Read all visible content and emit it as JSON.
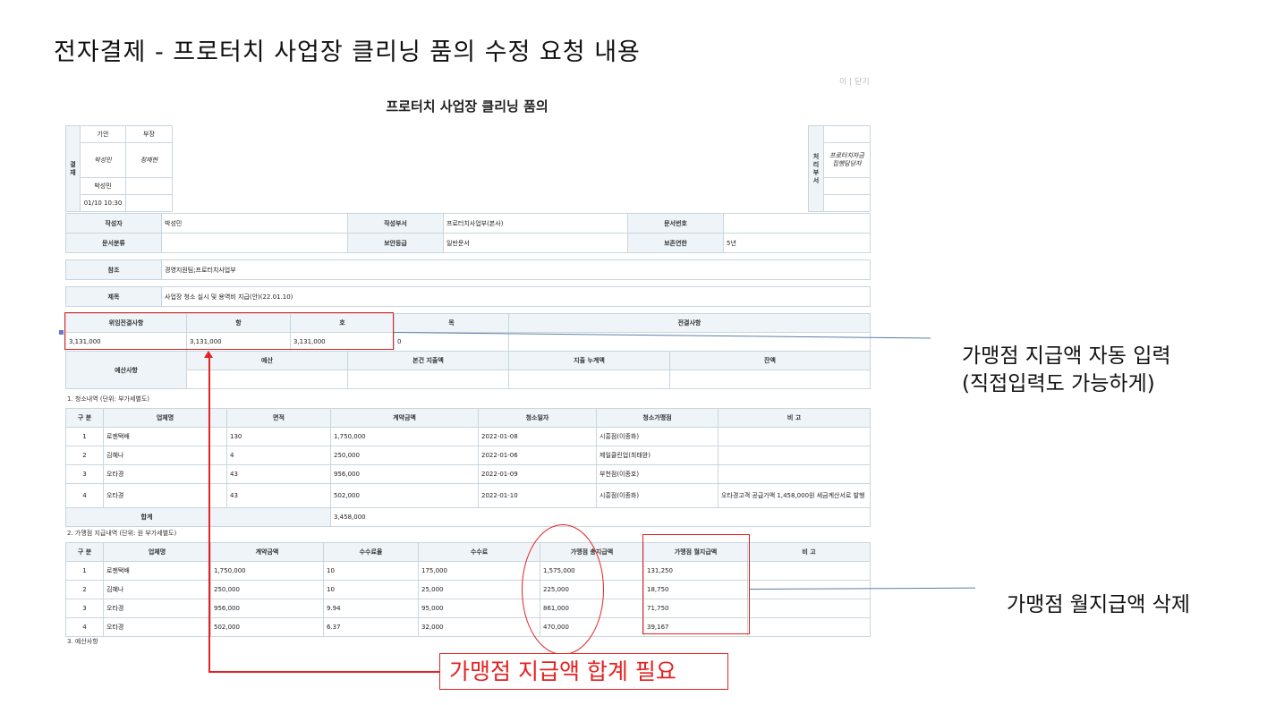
{
  "slide_title": "전자결제  - 프로터치 사업장 클리닝 품의 수정 요청 내용",
  "doc": {
    "top_right": "이 | 닫기",
    "title": "프로터치 사업장 클리닝 품의",
    "approval": {
      "side_label": "결\n재",
      "col1_header": "기안",
      "col2_header": "부장",
      "signer1": "박성민",
      "signer2": "정재현",
      "name1": "박성민",
      "datetime1": "01/10 10:30"
    },
    "process_dept": {
      "side_label": "처\n리\n부\n서",
      "value": "프로터치자금\n집행담당자"
    },
    "info": {
      "author_label": "작성자",
      "author": "박성민",
      "dept_label": "작성부서",
      "dept": "프로터치사업부(본사)",
      "docno_label": "문서번호",
      "docno": "",
      "category_label": "문서분류",
      "category": "",
      "security_label": "보안등급",
      "security": "일반문서",
      "retention_label": "보존연한",
      "retention": "5년"
    },
    "ref_label": "참조",
    "ref": "경영지원팀;프로터치사업부",
    "subject_label": "제목",
    "subject": "사업장 청소 실시 및 용역비 지급(안)(22.01.10)",
    "budget_top": {
      "headers": [
        "위임전결사항",
        "항",
        "호",
        "목",
        "전결사항"
      ],
      "values": [
        "3,131,000",
        "3,131,000",
        "3,131,000",
        "0",
        ""
      ]
    },
    "budget": {
      "label": "예산사항",
      "headers": [
        "예산",
        "본건 지출액",
        "지출 누계액",
        "잔액"
      ],
      "values": [
        "",
        "",
        "",
        ""
      ]
    },
    "section1": {
      "title": "1. 청소내역 (단위: 부가세별도)",
      "headers": [
        "구 분",
        "업체명",
        "면적",
        "계약금액",
        "청소일자",
        "청소가맹점",
        "비 고"
      ],
      "rows": [
        [
          "1",
          "로젠택배",
          "130",
          "1,750,000",
          "2022-01-08",
          "시흥점(이종화)",
          ""
        ],
        [
          "2",
          "김혜나",
          "4",
          "250,000",
          "2022-01-06",
          "제일클린업(최태완)",
          ""
        ],
        [
          "3",
          "오타경",
          "43",
          "956,000",
          "2022-01-09",
          "부천점(이종호)",
          ""
        ],
        [
          "4",
          "오타경",
          "43",
          "502,000",
          "2022-01-10",
          "시흥점(이종화)",
          "오타경고객 공급가액 1,458,000원 세금계산서로 발행"
        ]
      ],
      "total_label": "합계",
      "total_value": "3,458,000"
    },
    "section2": {
      "title": "2. 가맹점 지급내역 (단위: 원 부가세별도)",
      "headers": [
        "구 분",
        "업체명",
        "계약금액",
        "수수료율",
        "수수료",
        "가맹점 총지급액",
        "가맹점 월지급액",
        "비 고"
      ],
      "rows": [
        [
          "1",
          "로젠택배",
          "1,750,000",
          "10",
          "175,000",
          "1,575,000",
          "131,250",
          ""
        ],
        [
          "2",
          "김혜나",
          "250,000",
          "10",
          "25,000",
          "225,000",
          "18,750",
          ""
        ],
        [
          "3",
          "오타경",
          "956,000",
          "9.94",
          "95,000",
          "861,000",
          "71,750",
          ""
        ],
        [
          "4",
          "오타경",
          "502,000",
          "6.37",
          "32,000",
          "470,000",
          "39,167",
          ""
        ]
      ]
    },
    "section3_title": "3. 예산사항"
  },
  "annotations": {
    "auto_input_line1": "가맹점 지급액 자동 입력",
    "auto_input_line2": "(직접입력도 가능하게)",
    "delete_monthly": "가맹점 월지급액 삭제",
    "total_needed": "가맹점 지급액 합계 필요"
  },
  "colors": {
    "annotation_red": "#e52222",
    "connector_blue": "#5a7fa5",
    "header_bg": "#eef4f8",
    "border": "#c9d6de"
  }
}
